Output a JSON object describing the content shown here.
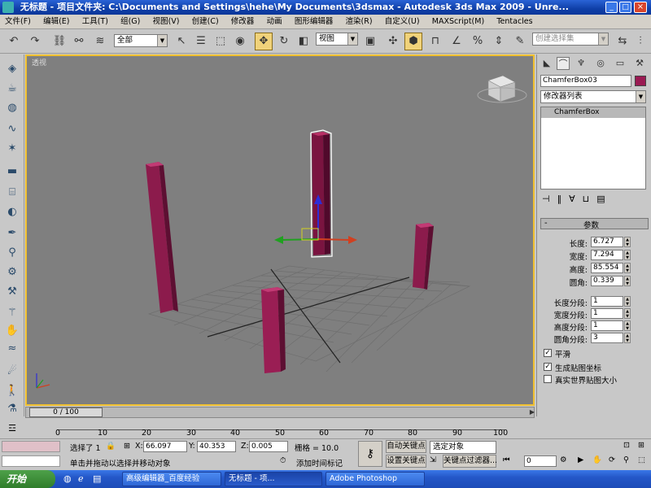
{
  "window": {
    "title": "无标题   - 项目文件夹: C:\\Documents and Settings\\hehe\\My Documents\\3dsmax   - Autodesk 3ds Max  2009  - Unre..."
  },
  "menu": [
    "文件(F)",
    "编辑(E)",
    "工具(T)",
    "组(G)",
    "视图(V)",
    "创建(C)",
    "修改器",
    "动画",
    "图形编辑器",
    "渲染(R)",
    "自定义(U)",
    "MAXScript(M)",
    "Tentacles"
  ],
  "toolbar": {
    "selection_filter": "全部",
    "ref_coord": "视图",
    "named_selection_placeholder": "创建选择集"
  },
  "viewport": {
    "label": "透视"
  },
  "panel": {
    "object_name": "ChamferBox03",
    "modifier_list": "修改器列表",
    "stack_item": "ChamferBox",
    "rollout_title": "参数",
    "params": [
      {
        "label": "长度:",
        "value": "6.727"
      },
      {
        "label": "宽度:",
        "value": "7.294"
      },
      {
        "label": "高度:",
        "value": "85.554"
      },
      {
        "label": "圆角:",
        "value": "0.339"
      }
    ],
    "segments": [
      {
        "label": "长度分段:",
        "value": "1"
      },
      {
        "label": "宽度分段:",
        "value": "1"
      },
      {
        "label": "高度分段:",
        "value": "1"
      },
      {
        "label": "圆角分段:",
        "value": "3"
      }
    ],
    "checks": [
      {
        "label": "平滑",
        "checked": "✓"
      },
      {
        "label": "生成贴图坐标",
        "checked": "✓"
      },
      {
        "label": "真实世界贴图大小",
        "checked": ""
      }
    ]
  },
  "timeline": {
    "slider": "0 / 100",
    "ticks": [
      "0",
      "10",
      "20",
      "30",
      "40",
      "50",
      "60",
      "70",
      "80",
      "90",
      "100"
    ]
  },
  "status": {
    "selected": "选择了 1",
    "x_label": "X:",
    "x_value": "66.097",
    "y_label": "Y:",
    "y_value": "40.353",
    "z_label": "Z:",
    "z_value": "0.005",
    "grid": "栅格 = 10.0",
    "auto_key": "自动关键点",
    "set_key": "设置关键点",
    "selected_objects": "选定对象",
    "key_filters": "关键点过滤器...",
    "frame": "0",
    "prompt": "单击并拖动以选择并移动对象",
    "add_time_tag": "添加时间标记"
  },
  "taskbar": {
    "start": "开始",
    "tasks": [
      "高级编辑器_百度经验",
      "无标题  - 项...",
      "Adobe Photoshop"
    ]
  }
}
